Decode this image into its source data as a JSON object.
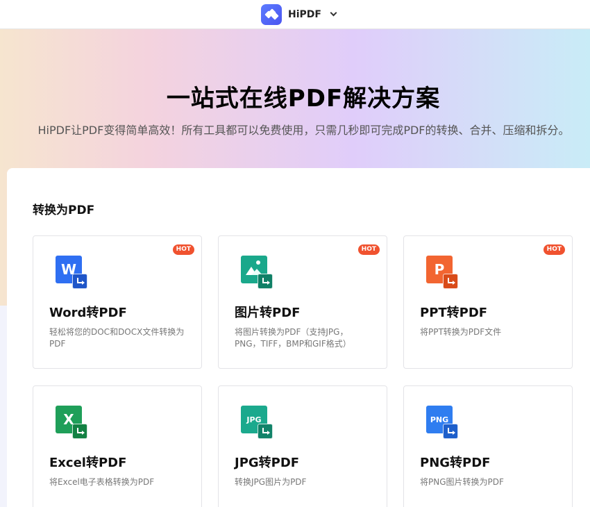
{
  "header": {
    "brand_name": "HiPDF",
    "logo_icon": "hipdf-logo-icon",
    "dropdown_icon": "chevron-down-icon"
  },
  "hero": {
    "title": "一站式在线PDF解决方案",
    "subtitle": "HiPDF让PDF变得简单高效！所有工具都可以免费使用，只需几秒即可完成PDF的转换、合并、压缩和拆分。"
  },
  "section": {
    "title": "转换为PDF"
  },
  "tools": [
    {
      "title": "Word转PDF",
      "desc": "轻松将您的DOC和DOCX文件转换为PDF",
      "badge": "HOT",
      "icon_letter": "W",
      "icon": "word-to-pdf-icon",
      "color": "#2f6ff2"
    },
    {
      "title": "图片转PDF",
      "desc": "将图片转换为PDF（支持JPG，PNG，TIFF，BMP和GIF格式）",
      "badge": "HOT",
      "icon_letter": "",
      "icon": "image-to-pdf-icon",
      "color": "#1aa88b"
    },
    {
      "title": "PPT转PDF",
      "desc": "将PPT转换为PDF文件",
      "badge": "HOT",
      "icon_letter": "P",
      "icon": "ppt-to-pdf-icon",
      "color": "#f26531"
    },
    {
      "title": "Excel转PDF",
      "desc": "将Excel电子表格转换为PDF",
      "badge": "",
      "icon_letter": "X",
      "icon": "excel-to-pdf-icon",
      "color": "#1f9f59"
    },
    {
      "title": "JPG转PDF",
      "desc": "转换JPG图片为PDF",
      "badge": "",
      "icon_letter": "JPG",
      "icon": "jpg-to-pdf-icon",
      "color": "#1ba98d"
    },
    {
      "title": "PNG转PDF",
      "desc": "将PNG图片转换为PDF",
      "badge": "",
      "icon_letter": "PNG",
      "icon": "png-to-pdf-icon",
      "color": "#2f7df0"
    }
  ]
}
